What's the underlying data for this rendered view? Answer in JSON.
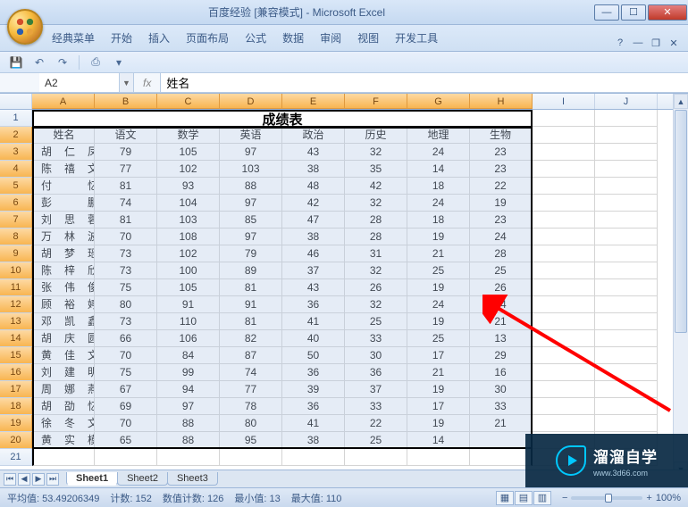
{
  "window": {
    "title": "百度经验  [兼容模式] - Microsoft Excel"
  },
  "ribbon_tabs": [
    "经典菜单",
    "开始",
    "插入",
    "页面布局",
    "公式",
    "数据",
    "审阅",
    "视图",
    "开发工具"
  ],
  "namebox": "A2",
  "formula": "姓名",
  "columns": [
    "A",
    "B",
    "C",
    "D",
    "E",
    "F",
    "G",
    "H",
    "I",
    "J"
  ],
  "selected_cols": [
    "A",
    "B",
    "C",
    "D",
    "E",
    "F",
    "G",
    "H"
  ],
  "title_cell": "成绩表",
  "header_row": [
    "姓名",
    "语文",
    "数学",
    "英语",
    "政治",
    "历史",
    "地理",
    "生物"
  ],
  "data_rows": [
    [
      "胡　仁　凤",
      "79",
      "105",
      "97",
      "43",
      "32",
      "24",
      "23"
    ],
    [
      "陈　禧　文",
      "77",
      "102",
      "103",
      "38",
      "35",
      "14",
      "23"
    ],
    [
      "付　　　忆",
      "81",
      "93",
      "88",
      "48",
      "42",
      "18",
      "22"
    ],
    [
      "彭　　　鹏",
      "74",
      "104",
      "97",
      "42",
      "32",
      "24",
      "19"
    ],
    [
      "刘　思　蓉",
      "81",
      "103",
      "85",
      "47",
      "28",
      "18",
      "23"
    ],
    [
      "万　林　波",
      "70",
      "108",
      "97",
      "38",
      "28",
      "19",
      "24"
    ],
    [
      "胡　梦　瑶",
      "73",
      "102",
      "79",
      "46",
      "31",
      "21",
      "28"
    ],
    [
      "陈　梓　欣",
      "73",
      "100",
      "89",
      "37",
      "32",
      "25",
      "25"
    ],
    [
      "张　伟　俊",
      "75",
      "105",
      "81",
      "43",
      "26",
      "19",
      "26"
    ],
    [
      "顾　裕　婷",
      "80",
      "91",
      "91",
      "36",
      "32",
      "24",
      "24"
    ],
    [
      "邓　凯　鑫",
      "73",
      "110",
      "81",
      "41",
      "25",
      "19",
      "21"
    ],
    [
      "胡　庆　圆",
      "66",
      "106",
      "82",
      "40",
      "33",
      "25",
      "13"
    ],
    [
      "黄　佳　文",
      "70",
      "84",
      "87",
      "50",
      "30",
      "17",
      "29"
    ],
    [
      "刘　建　明",
      "75",
      "99",
      "74",
      "36",
      "36",
      "21",
      "16"
    ],
    [
      "周　娜　燕",
      "67",
      "94",
      "77",
      "39",
      "37",
      "19",
      "30"
    ],
    [
      "胡　劭　忆",
      "69",
      "97",
      "78",
      "36",
      "33",
      "17",
      "33"
    ],
    [
      "徐　冬　文",
      "70",
      "88",
      "80",
      "41",
      "22",
      "19",
      "21"
    ],
    [
      "黄　实　模",
      "65",
      "88",
      "95",
      "38",
      "25",
      "14",
      ""
    ]
  ],
  "row_heads": [
    "1",
    "2",
    "3",
    "4",
    "5",
    "6",
    "7",
    "8",
    "9",
    "10",
    "11",
    "12",
    "13",
    "14",
    "15",
    "16",
    "17",
    "18",
    "19",
    "20",
    "21"
  ],
  "selected_row_start": 2,
  "selected_row_end": 20,
  "sheets": [
    "Sheet1",
    "Sheet2",
    "Sheet3"
  ],
  "active_sheet": 0,
  "status": {
    "avg_label": "平均值: ",
    "avg": "53.49206349",
    "count_label": "计数: ",
    "count": "152",
    "numcount_label": "数值计数: ",
    "numcount": "126",
    "min_label": "最小值: ",
    "min": "13",
    "max_label": "最大值: ",
    "max": "110",
    "zoom": "100%"
  },
  "watermark": {
    "brand": "溜溜自学",
    "url": "www.3d66.com"
  }
}
